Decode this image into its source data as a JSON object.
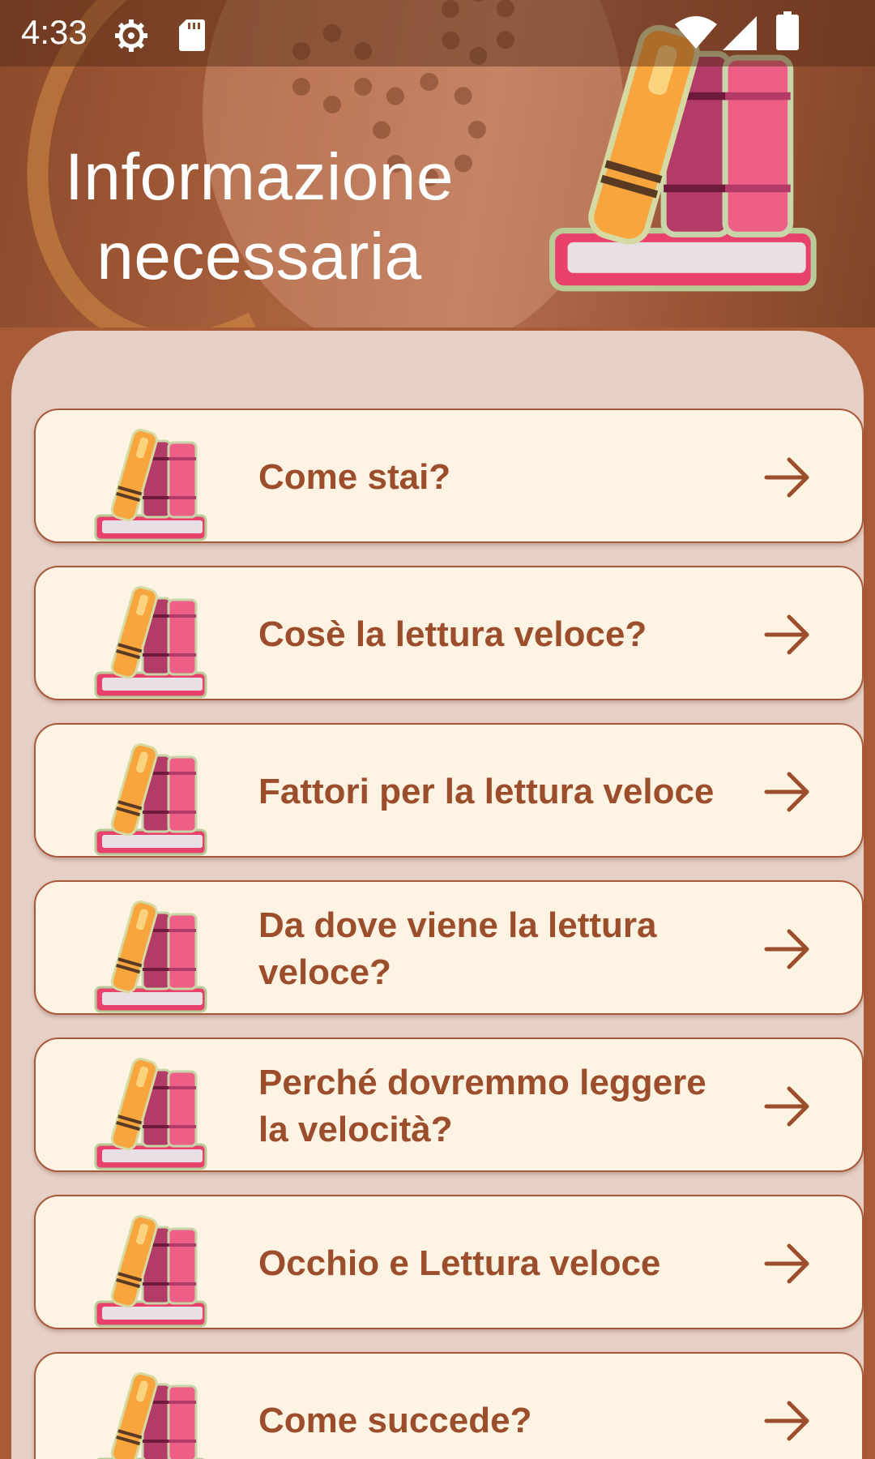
{
  "status_bar": {
    "time": "4:33",
    "icons": [
      "settings-gear-icon",
      "sd-card-icon",
      "wifi-icon",
      "cell-signal-icon",
      "battery-icon"
    ]
  },
  "header": {
    "title": "Informazione necessaria",
    "illustration": "books-illustration"
  },
  "colors": {
    "accent": "#9c4d2c",
    "card_background": "#fdf3e3",
    "panel_background": "#e6cfc4",
    "page_background": "#a95a37"
  },
  "list": {
    "items": [
      {
        "label": "Come stai?",
        "icon": "books-icon",
        "trailing": "arrow-right-icon"
      },
      {
        "label": "Cosè la lettura veloce?",
        "icon": "books-icon",
        "trailing": "arrow-right-icon"
      },
      {
        "label": "Fattori per la lettura veloce",
        "icon": "books-icon",
        "trailing": "arrow-right-icon"
      },
      {
        "label": "Da dove viene la lettura veloce?",
        "icon": "books-icon",
        "trailing": "arrow-right-icon"
      },
      {
        "label": "Perché dovremmo leggere la velocità?",
        "icon": "books-icon",
        "trailing": "arrow-right-icon"
      },
      {
        "label": "Occhio e Lettura veloce",
        "icon": "books-icon",
        "trailing": "arrow-right-icon"
      },
      {
        "label": "Come succede?",
        "icon": "books-icon",
        "trailing": "arrow-right-icon"
      }
    ]
  }
}
